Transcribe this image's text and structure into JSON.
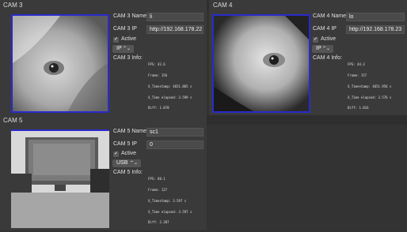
{
  "cam3": {
    "title": "CAM 3",
    "name_label": "CAM 3 Name",
    "name_value": "li",
    "ip_label": "CAM 3 IP",
    "ip_value": "http://192.168.178.22",
    "active_label": "Active",
    "source": "IP",
    "info_label": "CAM 3 Info:",
    "info": [
      "FPS: 42.6",
      "Frame: 156",
      "X_Timestamp: 4651.865 s",
      "X_Time elapsed: 3.599 s",
      "Diff: 1.070"
    ]
  },
  "cam4": {
    "title": "CAM 4",
    "name_label": "CAM 4 Name",
    "name_value": "lo",
    "ip_label": "CAM 4 IP",
    "ip_value": "http://192.168.178.23",
    "active_label": "Active",
    "source": "IP",
    "info_label": "CAM 4 Info:",
    "info": [
      "FPS: 44.3",
      "Frame: 157",
      "X_Timestamp: 4651.956 s",
      "X_Time elapsed: 3.576 s",
      "Diff: 1.016"
    ]
  },
  "cam5": {
    "title": "CAM 5",
    "name_label": "CAM 5 Name",
    "name_value": "sc1",
    "ip_label": "CAM 5 IP",
    "ip_value": "0",
    "active_label": "Active",
    "source": "USB",
    "info_label": "CAM 5 Info:",
    "info": [
      "FPS: 60.1",
      "Frame: 127",
      "X_Timestamp: 3.597 s",
      "X_Time elapsed: 3.597 s",
      "Diff: 2.387"
    ]
  },
  "icons": {
    "check": "checkmark-icon",
    "select": "up-down-chevron-icon"
  },
  "colors": {
    "view_border": "#2a2acc",
    "background": "#323232"
  }
}
